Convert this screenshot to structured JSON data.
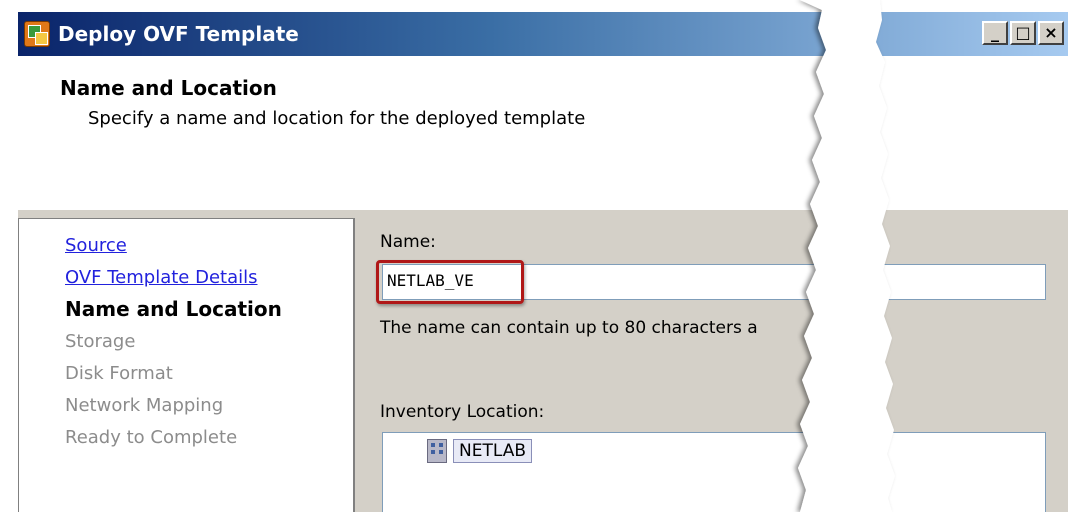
{
  "window": {
    "title": "Deploy OVF Template",
    "controls": {
      "minimize": "_",
      "maximize": "□",
      "close": "×"
    }
  },
  "header": {
    "title": "Name and Location",
    "subtitle": "Specify a name and location for the deployed template"
  },
  "steps": [
    {
      "label": "Source",
      "state": "completed"
    },
    {
      "label": "OVF Template Details",
      "state": "completed"
    },
    {
      "label": "Name and Location",
      "state": "current"
    },
    {
      "label": "Storage",
      "state": "pending"
    },
    {
      "label": "Disk Format",
      "state": "pending"
    },
    {
      "label": "Network Mapping",
      "state": "pending"
    },
    {
      "label": "Ready to Complete",
      "state": "pending"
    }
  ],
  "form": {
    "name_label": "Name:",
    "name_value": "NETLAB_VE",
    "name_hint": "The name can contain up to 80 characters a",
    "inventory_label": "Inventory Location:",
    "inventory_items": [
      {
        "label": "NETLAB",
        "icon": "datacenter-icon"
      }
    ]
  },
  "colors": {
    "titlebar_start": "#0a246a",
    "titlebar_end": "#a6caf0",
    "dialog_bg": "#d4d0c8",
    "link": "#2222dd",
    "highlight_box": "#b01818"
  }
}
